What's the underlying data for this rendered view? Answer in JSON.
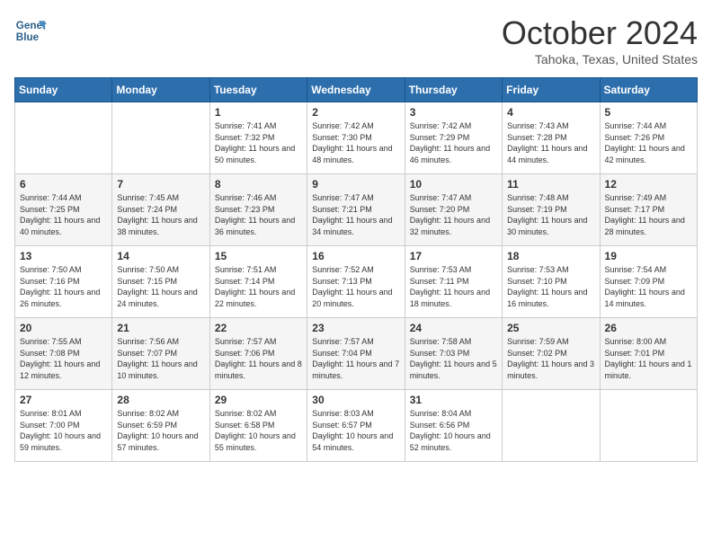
{
  "header": {
    "logo_line1": "General",
    "logo_line2": "Blue",
    "month_title": "October 2024",
    "location": "Tahoka, Texas, United States"
  },
  "days_of_week": [
    "Sunday",
    "Monday",
    "Tuesday",
    "Wednesday",
    "Thursday",
    "Friday",
    "Saturday"
  ],
  "weeks": [
    [
      {
        "day": "",
        "info": ""
      },
      {
        "day": "",
        "info": ""
      },
      {
        "day": "1",
        "info": "Sunrise: 7:41 AM\nSunset: 7:32 PM\nDaylight: 11 hours and 50 minutes."
      },
      {
        "day": "2",
        "info": "Sunrise: 7:42 AM\nSunset: 7:30 PM\nDaylight: 11 hours and 48 minutes."
      },
      {
        "day": "3",
        "info": "Sunrise: 7:42 AM\nSunset: 7:29 PM\nDaylight: 11 hours and 46 minutes."
      },
      {
        "day": "4",
        "info": "Sunrise: 7:43 AM\nSunset: 7:28 PM\nDaylight: 11 hours and 44 minutes."
      },
      {
        "day": "5",
        "info": "Sunrise: 7:44 AM\nSunset: 7:26 PM\nDaylight: 11 hours and 42 minutes."
      }
    ],
    [
      {
        "day": "6",
        "info": "Sunrise: 7:44 AM\nSunset: 7:25 PM\nDaylight: 11 hours and 40 minutes."
      },
      {
        "day": "7",
        "info": "Sunrise: 7:45 AM\nSunset: 7:24 PM\nDaylight: 11 hours and 38 minutes."
      },
      {
        "day": "8",
        "info": "Sunrise: 7:46 AM\nSunset: 7:23 PM\nDaylight: 11 hours and 36 minutes."
      },
      {
        "day": "9",
        "info": "Sunrise: 7:47 AM\nSunset: 7:21 PM\nDaylight: 11 hours and 34 minutes."
      },
      {
        "day": "10",
        "info": "Sunrise: 7:47 AM\nSunset: 7:20 PM\nDaylight: 11 hours and 32 minutes."
      },
      {
        "day": "11",
        "info": "Sunrise: 7:48 AM\nSunset: 7:19 PM\nDaylight: 11 hours and 30 minutes."
      },
      {
        "day": "12",
        "info": "Sunrise: 7:49 AM\nSunset: 7:17 PM\nDaylight: 11 hours and 28 minutes."
      }
    ],
    [
      {
        "day": "13",
        "info": "Sunrise: 7:50 AM\nSunset: 7:16 PM\nDaylight: 11 hours and 26 minutes."
      },
      {
        "day": "14",
        "info": "Sunrise: 7:50 AM\nSunset: 7:15 PM\nDaylight: 11 hours and 24 minutes."
      },
      {
        "day": "15",
        "info": "Sunrise: 7:51 AM\nSunset: 7:14 PM\nDaylight: 11 hours and 22 minutes."
      },
      {
        "day": "16",
        "info": "Sunrise: 7:52 AM\nSunset: 7:13 PM\nDaylight: 11 hours and 20 minutes."
      },
      {
        "day": "17",
        "info": "Sunrise: 7:53 AM\nSunset: 7:11 PM\nDaylight: 11 hours and 18 minutes."
      },
      {
        "day": "18",
        "info": "Sunrise: 7:53 AM\nSunset: 7:10 PM\nDaylight: 11 hours and 16 minutes."
      },
      {
        "day": "19",
        "info": "Sunrise: 7:54 AM\nSunset: 7:09 PM\nDaylight: 11 hours and 14 minutes."
      }
    ],
    [
      {
        "day": "20",
        "info": "Sunrise: 7:55 AM\nSunset: 7:08 PM\nDaylight: 11 hours and 12 minutes."
      },
      {
        "day": "21",
        "info": "Sunrise: 7:56 AM\nSunset: 7:07 PM\nDaylight: 11 hours and 10 minutes."
      },
      {
        "day": "22",
        "info": "Sunrise: 7:57 AM\nSunset: 7:06 PM\nDaylight: 11 hours and 8 minutes."
      },
      {
        "day": "23",
        "info": "Sunrise: 7:57 AM\nSunset: 7:04 PM\nDaylight: 11 hours and 7 minutes."
      },
      {
        "day": "24",
        "info": "Sunrise: 7:58 AM\nSunset: 7:03 PM\nDaylight: 11 hours and 5 minutes."
      },
      {
        "day": "25",
        "info": "Sunrise: 7:59 AM\nSunset: 7:02 PM\nDaylight: 11 hours and 3 minutes."
      },
      {
        "day": "26",
        "info": "Sunrise: 8:00 AM\nSunset: 7:01 PM\nDaylight: 11 hours and 1 minute."
      }
    ],
    [
      {
        "day": "27",
        "info": "Sunrise: 8:01 AM\nSunset: 7:00 PM\nDaylight: 10 hours and 59 minutes."
      },
      {
        "day": "28",
        "info": "Sunrise: 8:02 AM\nSunset: 6:59 PM\nDaylight: 10 hours and 57 minutes."
      },
      {
        "day": "29",
        "info": "Sunrise: 8:02 AM\nSunset: 6:58 PM\nDaylight: 10 hours and 55 minutes."
      },
      {
        "day": "30",
        "info": "Sunrise: 8:03 AM\nSunset: 6:57 PM\nDaylight: 10 hours and 54 minutes."
      },
      {
        "day": "31",
        "info": "Sunrise: 8:04 AM\nSunset: 6:56 PM\nDaylight: 10 hours and 52 minutes."
      },
      {
        "day": "",
        "info": ""
      },
      {
        "day": "",
        "info": ""
      }
    ]
  ]
}
